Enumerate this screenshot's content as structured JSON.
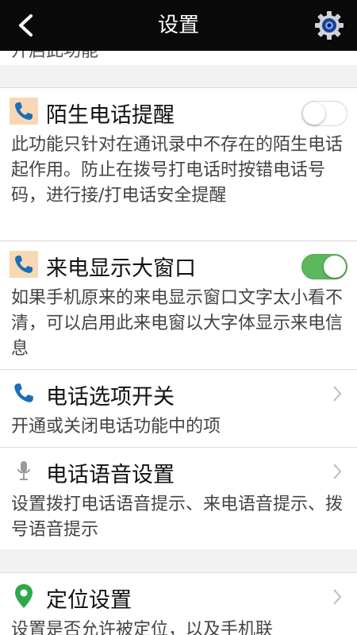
{
  "header": {
    "title": "设置"
  },
  "partial_row": {
    "text": "开启此功能"
  },
  "rows": [
    {
      "title": "陌生电话提醒",
      "icon": "phone-icon",
      "desc": "此功能只针对在通讯录中不存在的陌生电话起作用。防止在拨号打电话时按错电话号码，进行接/打电话安全提醒",
      "switch": "off"
    },
    {
      "title": "来电显示大窗口",
      "icon": "phone-icon",
      "desc": "如果手机原来的来电显示窗口文字太小看不清，可以启用此来电窗以大字体显示来电信息",
      "switch": "on"
    },
    {
      "title": "电话选项开关",
      "icon": "phone-icon",
      "desc": "开通或关闭电话功能中的项"
    },
    {
      "title": "电话语音设置",
      "icon": "microphone-icon",
      "desc": "设置拨打电话语音提示、来电语音提示、拨号语音提示"
    },
    {
      "title": "定位设置",
      "icon": "location-pin-icon",
      "desc": "设置是否允许被定位，以及手机联"
    }
  ],
  "colors": {
    "header_bg": "#0a0a0a",
    "switch_on": "#5cb85c",
    "phone_blue": "#1b6fb5",
    "location_green": "#2ea84a"
  }
}
